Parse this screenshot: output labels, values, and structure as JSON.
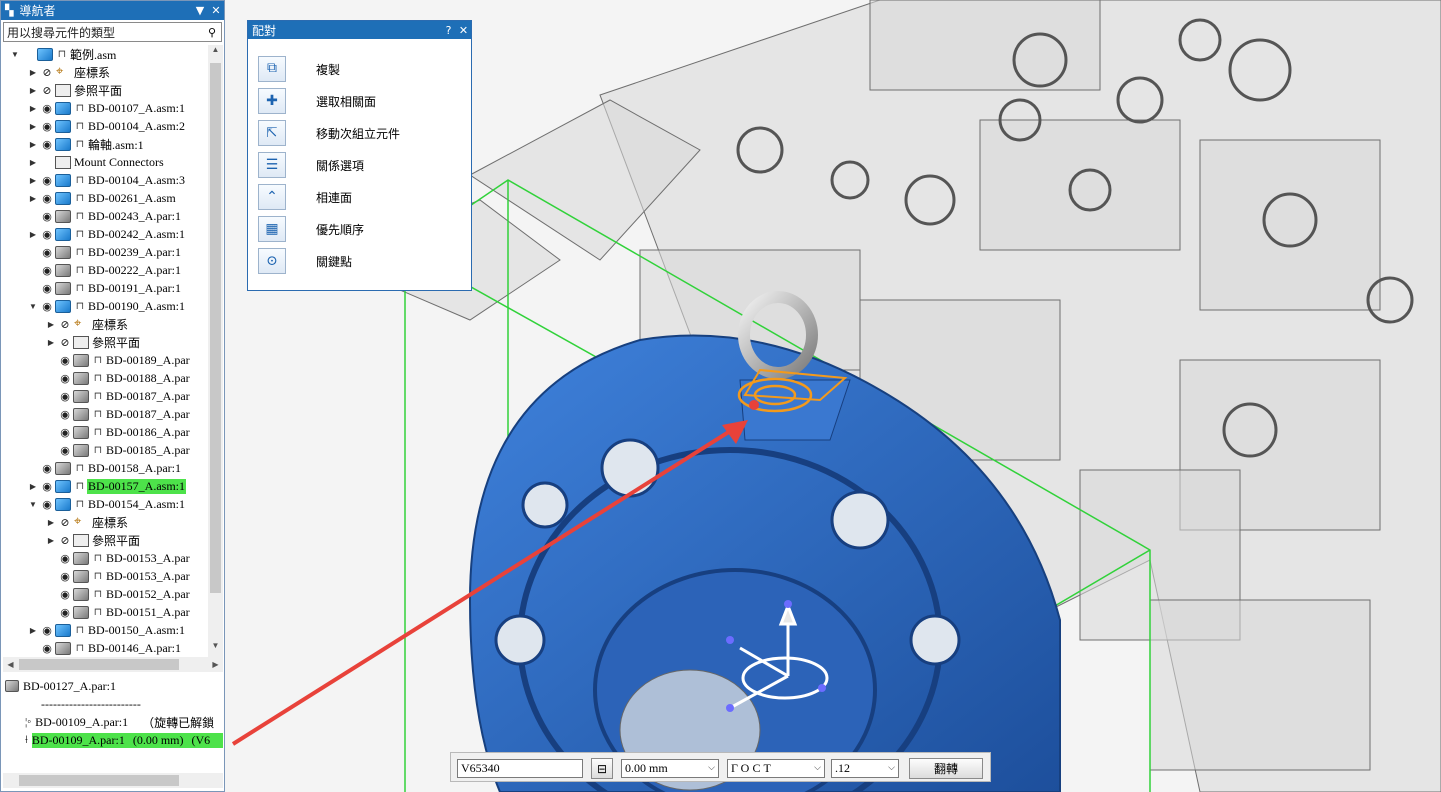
{
  "navigator": {
    "title": "導航者",
    "search_placeholder": "用以搜尋元件的類型",
    "tree": [
      {
        "indent": 0,
        "exp": "▼",
        "eye": false,
        "icon": "asm",
        "lock": true,
        "label": "範例.asm",
        "sel": false
      },
      {
        "indent": 1,
        "exp": "▶",
        "eye": "hidden",
        "icon": "csys",
        "lock": false,
        "label": "座標系",
        "sel": false
      },
      {
        "indent": 1,
        "exp": "▶",
        "eye": "hidden",
        "icon": "plane",
        "lock": false,
        "label": "參照平面",
        "sel": false
      },
      {
        "indent": 1,
        "exp": "▶",
        "eye": "visible",
        "icon": "asm",
        "lock": true,
        "label": "BD-00107_A.asm:1",
        "sel": false
      },
      {
        "indent": 1,
        "exp": "▶",
        "eye": "visible",
        "icon": "asm",
        "lock": true,
        "label": "BD-00104_A.asm:2",
        "sel": false
      },
      {
        "indent": 1,
        "exp": "▶",
        "eye": "visible",
        "icon": "asm",
        "lock": true,
        "label": "輪軸.asm:1",
        "sel": false
      },
      {
        "indent": 1,
        "exp": "▶",
        "eye": false,
        "icon": "plane",
        "lock": false,
        "label": "Mount Connectors",
        "sel": false
      },
      {
        "indent": 1,
        "exp": "▶",
        "eye": "visible",
        "icon": "asm",
        "lock": true,
        "label": "BD-00104_A.asm:3",
        "sel": false
      },
      {
        "indent": 1,
        "exp": "▶",
        "eye": "visible",
        "icon": "asm",
        "lock": true,
        "label": "BD-00261_A.asm",
        "sel": false
      },
      {
        "indent": 1,
        "exp": "",
        "eye": "visible",
        "icon": "par",
        "lock": true,
        "label": "BD-00243_A.par:1",
        "sel": false
      },
      {
        "indent": 1,
        "exp": "▶",
        "eye": "visible",
        "icon": "asm",
        "lock": true,
        "label": "BD-00242_A.asm:1",
        "sel": false
      },
      {
        "indent": 1,
        "exp": "",
        "eye": "visible",
        "icon": "par",
        "lock": true,
        "label": "BD-00239_A.par:1",
        "sel": false
      },
      {
        "indent": 1,
        "exp": "",
        "eye": "visible",
        "icon": "par",
        "lock": true,
        "label": "BD-00222_A.par:1",
        "sel": false
      },
      {
        "indent": 1,
        "exp": "",
        "eye": "visible",
        "icon": "par",
        "lock": true,
        "label": "BD-00191_A.par:1",
        "sel": false
      },
      {
        "indent": 1,
        "exp": "▼",
        "eye": "visible",
        "icon": "asm",
        "lock": true,
        "label": "BD-00190_A.asm:1",
        "sel": false
      },
      {
        "indent": 2,
        "exp": "▶",
        "eye": "hidden",
        "icon": "csys",
        "lock": false,
        "label": "座標系",
        "sel": false
      },
      {
        "indent": 2,
        "exp": "▶",
        "eye": "hidden",
        "icon": "plane",
        "lock": false,
        "label": "參照平面",
        "sel": false
      },
      {
        "indent": 2,
        "exp": "",
        "eye": "visible",
        "icon": "par",
        "lock": true,
        "label": "BD-00189_A.par",
        "sel": false
      },
      {
        "indent": 2,
        "exp": "",
        "eye": "visible",
        "icon": "par",
        "lock": true,
        "label": "BD-00188_A.par",
        "sel": false
      },
      {
        "indent": 2,
        "exp": "",
        "eye": "visible",
        "icon": "par",
        "lock": true,
        "label": "BD-00187_A.par",
        "sel": false
      },
      {
        "indent": 2,
        "exp": "",
        "eye": "visible",
        "icon": "par",
        "lock": true,
        "label": "BD-00187_A.par",
        "sel": false
      },
      {
        "indent": 2,
        "exp": "",
        "eye": "visible",
        "icon": "par",
        "lock": true,
        "label": "BD-00186_A.par",
        "sel": false
      },
      {
        "indent": 2,
        "exp": "",
        "eye": "visible",
        "icon": "par",
        "lock": true,
        "label": "BD-00185_A.par",
        "sel": false
      },
      {
        "indent": 1,
        "exp": "",
        "eye": "visible",
        "icon": "par",
        "lock": true,
        "label": "BD-00158_A.par:1",
        "sel": false
      },
      {
        "indent": 1,
        "exp": "▶",
        "eye": "visible",
        "icon": "asm",
        "lock": true,
        "label": "BD-00157_A.asm:1",
        "sel": true
      },
      {
        "indent": 1,
        "exp": "▼",
        "eye": "visible",
        "icon": "asm",
        "lock": true,
        "label": "BD-00154_A.asm:1",
        "sel": false
      },
      {
        "indent": 2,
        "exp": "▶",
        "eye": "hidden",
        "icon": "csys",
        "lock": false,
        "label": "座標系",
        "sel": false
      },
      {
        "indent": 2,
        "exp": "▶",
        "eye": "hidden",
        "icon": "plane",
        "lock": false,
        "label": "參照平面",
        "sel": false
      },
      {
        "indent": 2,
        "exp": "",
        "eye": "visible",
        "icon": "par",
        "lock": true,
        "label": "BD-00153_A.par",
        "sel": false
      },
      {
        "indent": 2,
        "exp": "",
        "eye": "visible",
        "icon": "par",
        "lock": true,
        "label": "BD-00153_A.par",
        "sel": false
      },
      {
        "indent": 2,
        "exp": "",
        "eye": "visible",
        "icon": "par",
        "lock": true,
        "label": "BD-00152_A.par",
        "sel": false
      },
      {
        "indent": 2,
        "exp": "",
        "eye": "visible",
        "icon": "par",
        "lock": true,
        "label": "BD-00151_A.par",
        "sel": false
      },
      {
        "indent": 1,
        "exp": "▶",
        "eye": "visible",
        "icon": "asm",
        "lock": true,
        "label": "BD-00150_A.asm:1",
        "sel": false
      },
      {
        "indent": 1,
        "exp": "",
        "eye": "visible",
        "icon": "par",
        "lock": true,
        "label": "BD-00146_A.par:1",
        "sel": false
      }
    ],
    "lower": {
      "part": "BD-00127_A.par:1",
      "separator": "-------------------------",
      "rel1": "BD-00109_A.par:1",
      "rel1_note": "（旋轉已解鎖",
      "rel2": "BD-00109_A.par:1",
      "rel2_note": "(0.00 mm)",
      "rel2_tail": "(V6"
    }
  },
  "assemble_dialog": {
    "title": "配對",
    "help": "?",
    "close": "✕",
    "items": [
      {
        "label": "複製",
        "icon": "copy-icon",
        "glyph": "⧉"
      },
      {
        "label": "選取相關面",
        "icon": "select-faces-icon",
        "glyph": "✚"
      },
      {
        "label": "移動次組立元件",
        "icon": "move-subassembly-icon",
        "glyph": "⇱"
      },
      {
        "label": "關係選項",
        "icon": "relation-options-icon",
        "glyph": "☰"
      },
      {
        "label": "相連面",
        "icon": "connected-faces-icon",
        "glyph": "⌃"
      },
      {
        "label": "優先順序",
        "icon": "priority-icon",
        "glyph": "▦"
      },
      {
        "label": "關鍵點",
        "icon": "keypoint-icon",
        "glyph": "⊙"
      }
    ]
  },
  "toolbar": {
    "relation_name": "V65340",
    "offset": "0.00 mm",
    "font": "ГОСТ",
    "size": ".12",
    "flip": "翻轉"
  },
  "colors": {
    "title_bar": "#1e6fb7",
    "selection": "#4de24a",
    "part_blue": "#2f6cc6",
    "highlight": "#f39a1c",
    "arrow": "#e8423a",
    "range_box": "#31d23a"
  }
}
